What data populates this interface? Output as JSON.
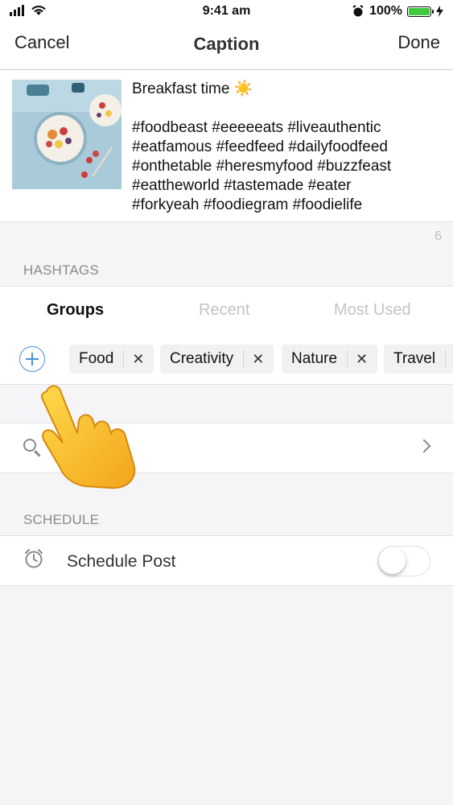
{
  "status_bar": {
    "time": "9:41 am",
    "battery": "100%"
  },
  "nav": {
    "cancel": "Cancel",
    "title": "Caption",
    "done": "Done"
  },
  "caption": {
    "text": "Breakfast time ☀️\n\n#foodbeast #eeeeeats #liveauthentic\n#eatfamous #feedfeed #dailyfoodfeed\n#onthetable #heresmyfood #buzzfeast\n#eattheworld #tastemade #eater\n#forkyeah #foodiegram #foodielife",
    "remaining_count": "6"
  },
  "hashtags": {
    "section_label": "HASHTAGS",
    "tabs": [
      {
        "label": "Groups"
      },
      {
        "label": "Recent"
      },
      {
        "label": "Most Used"
      }
    ],
    "groups": [
      {
        "label": "Food"
      },
      {
        "label": "Creativity"
      },
      {
        "label": "Nature"
      },
      {
        "label": "Travel"
      }
    ],
    "search_label": "ashtags"
  },
  "schedule": {
    "section_label": "SCHEDULE",
    "row_label": "Schedule Post",
    "enabled": false
  },
  "colors": {
    "accent": "#4a8fd6",
    "battery": "#3fc93f",
    "toggle_off": "#ffffff"
  }
}
